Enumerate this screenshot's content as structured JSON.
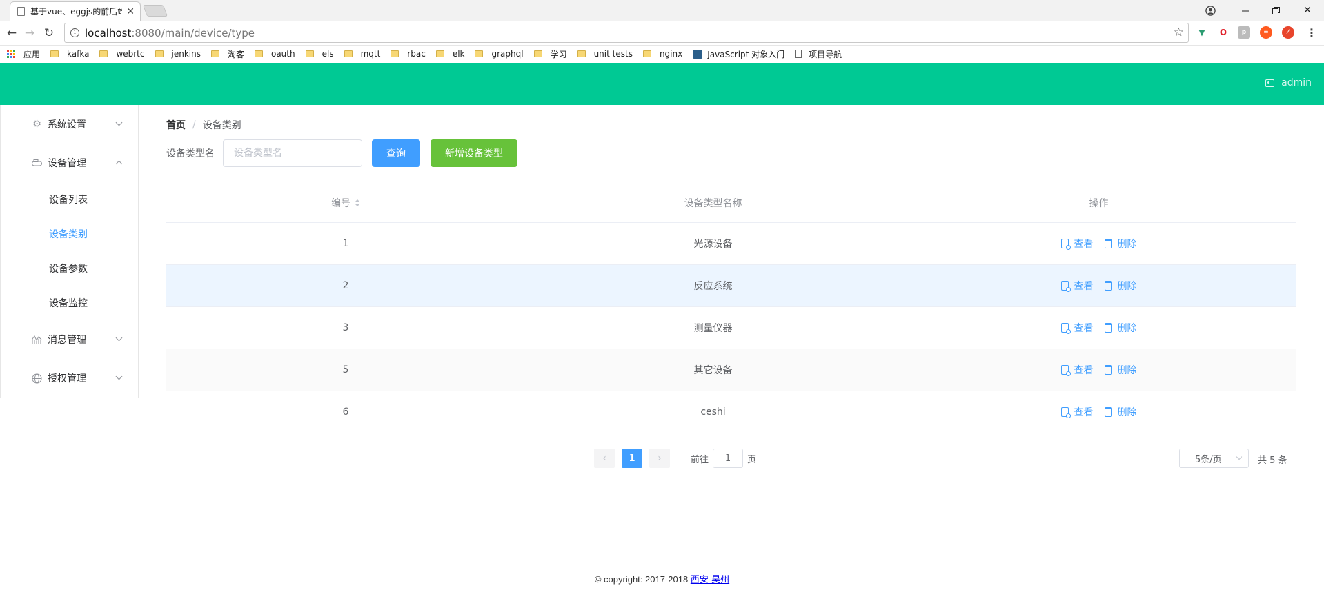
{
  "browser": {
    "tab_title": "基于vue、eggjs的前后端",
    "url_host": "localhost",
    "url_path": ":8080/main/device/type",
    "bookmarks": [
      "应用",
      "kafka",
      "webrtc",
      "jenkins",
      "淘客",
      "oauth",
      "els",
      "mqtt",
      "rbac",
      "elk",
      "graphql",
      "学习",
      "unit tests",
      "nginx",
      "JavaScript 对象入门",
      "项目导航"
    ]
  },
  "header": {
    "user": "admin",
    "color": "#00c994"
  },
  "sidebar": {
    "menus": [
      {
        "label": "系统设置",
        "icon": "gear-icon"
      },
      {
        "label": "设备管理",
        "icon": "device-icon"
      },
      {
        "label": "消息管理",
        "icon": "chart-icon"
      },
      {
        "label": "授权管理",
        "icon": "globe-icon"
      }
    ],
    "device_items": [
      "设备列表",
      "设备类别",
      "设备参数",
      "设备监控"
    ]
  },
  "breadcrumb": {
    "home": "首页",
    "current": "设备类别",
    "separator": "/"
  },
  "filter": {
    "label": "设备类型名",
    "placeholder": "设备类型名",
    "value": "",
    "search_label": "查询",
    "add_label": "新增设备类型"
  },
  "table": {
    "headers": {
      "id": "编号",
      "name": "设备类型名称",
      "ops": "操作"
    },
    "rows": [
      {
        "id": "1",
        "name": "光源设备"
      },
      {
        "id": "2",
        "name": "反应系统"
      },
      {
        "id": "3",
        "name": "测量仪器"
      },
      {
        "id": "5",
        "name": "其它设备"
      },
      {
        "id": "6",
        "name": "ceshi"
      }
    ],
    "view_label": "查看",
    "delete_label": "删除"
  },
  "pagination": {
    "current": "1",
    "goto_prefix": "前往",
    "goto_value": "1",
    "goto_suffix": "页",
    "page_size": "5条/页",
    "total": "共 5 条"
  },
  "footer": {
    "text": "© copyright: 2017-2018 ",
    "link": "西安-昊州"
  },
  "colors": {
    "primary": "#409eff",
    "success": "#67c23a"
  }
}
